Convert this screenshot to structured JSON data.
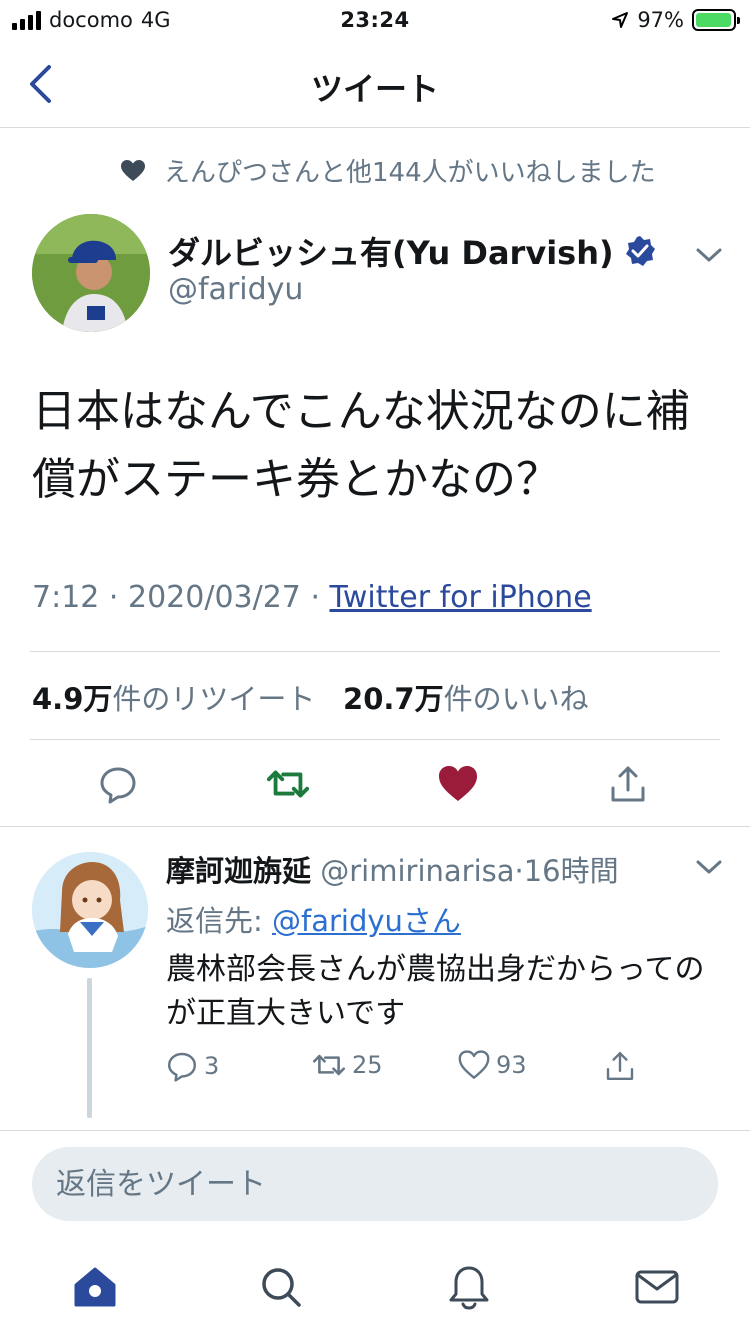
{
  "status_bar": {
    "carrier": "docomo",
    "network": "4G",
    "time": "23:24",
    "battery": "97%",
    "battery_level": 0.97
  },
  "header": {
    "title": "ツイート"
  },
  "social_context": {
    "text": "えんぴつさんと他144人がいいねしました"
  },
  "tweet": {
    "author_name": "ダルビッシュ有(Yu Darvish)",
    "author_handle": "@faridyu",
    "verified": true,
    "text": "日本はなんでこんな状況なのに補償がステーキ券とかなの？",
    "time": "7:12",
    "date": "2020/03/27",
    "separator": " · ",
    "source": "Twitter for iPhone",
    "retweets_count": "4.9万",
    "retweets_label": "件のリツイート",
    "likes_count": "20.7万",
    "likes_label": "件のいいね"
  },
  "reply": {
    "author_name": "摩訶迦旃延",
    "author_handle": "@rimirinarisa",
    "separator": "·",
    "time": "16時間",
    "reply_to_label": "返信先: ",
    "reply_to_handle": "@faridyuさん",
    "text": "農林部会長さんが農協出身だからってのが正直大きいです",
    "replies": "3",
    "retweets": "25",
    "likes": "93"
  },
  "composer": {
    "placeholder": "返信をツイート"
  },
  "colors": {
    "accent": "#2b4a9c",
    "retweet_active": "#1c7a3c",
    "like_active": "#9a1c3a",
    "secondary_text": "#657786"
  },
  "tabs": [
    "home-icon",
    "search-icon",
    "notifications-icon",
    "messages-icon"
  ]
}
